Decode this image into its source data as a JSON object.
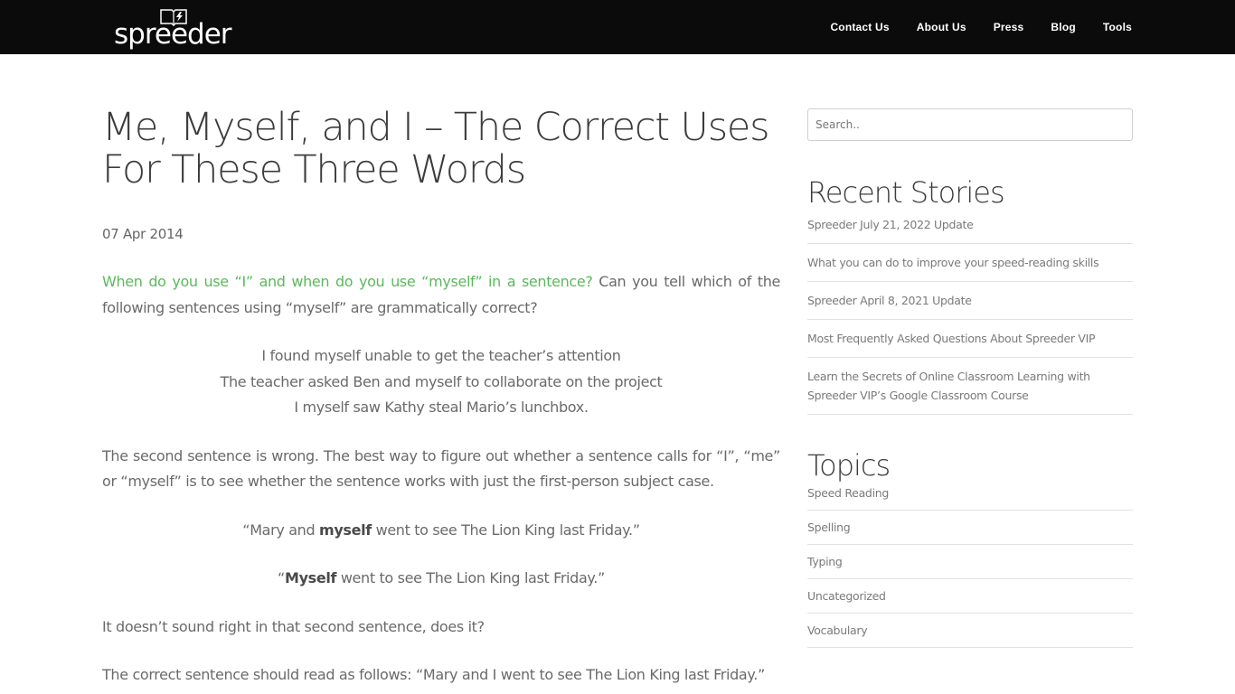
{
  "header": {
    "logo_text": "spreeder",
    "nav": [
      "Contact Us",
      "About Us",
      "Press",
      "Blog",
      "Tools"
    ]
  },
  "article": {
    "title": "Me, Myself, and I – The Correct Uses For These Three Words",
    "date": "07 Apr 2014",
    "intro_highlight": "When do you use “I” and when do you use “myself” in a sentence?",
    "intro_rest": " Can you tell which of the following sentences using “myself” are grammatically correct?",
    "examples": [
      "I found myself unable to get the teacher’s attention",
      "The teacher asked Ben and myself to collaborate on the project",
      "I myself saw Kathy steal Mario’s lunchbox."
    ],
    "para2": "The second sentence is wrong. The best way to figure out whether a sentence calls for “I”, “me” or “myself” is to see whether the sentence works with just the first-person subject case.",
    "ex1_pre": "“Mary and ",
    "ex1_bold": "myself",
    "ex1_post": " went to see The Lion King last Friday.”",
    "ex2_pre": "“",
    "ex2_bold": "Myself",
    "ex2_post": " went to see The Lion King last Friday.”",
    "para3": "It doesn’t sound right in that second sentence, does it?",
    "para4": "The correct sentence should read as follows:  “Mary and I went to see The Lion King last Friday.”"
  },
  "sidebar": {
    "search_placeholder": "Search..",
    "recent_title": "Recent Stories",
    "recent": [
      "Spreeder July 21, 2022 Update",
      "What you can do to improve your speed-reading skills",
      "Spreeder April 8, 2021 Update",
      "Most Frequently Asked Questions About Spreeder VIP",
      "Learn the Secrets of Online Classroom Learning with Spreeder VIP’s Google Classroom Course"
    ],
    "topics_title": "Topics",
    "topics": [
      "Speed Reading",
      "Spelling",
      "Typing",
      "Uncategorized",
      "Vocabulary"
    ]
  },
  "colors": {
    "header_bg": "#0b0b0b",
    "accent_green": "#5cb85c"
  },
  "icons": [
    "book-lightning-logo-icon"
  ]
}
